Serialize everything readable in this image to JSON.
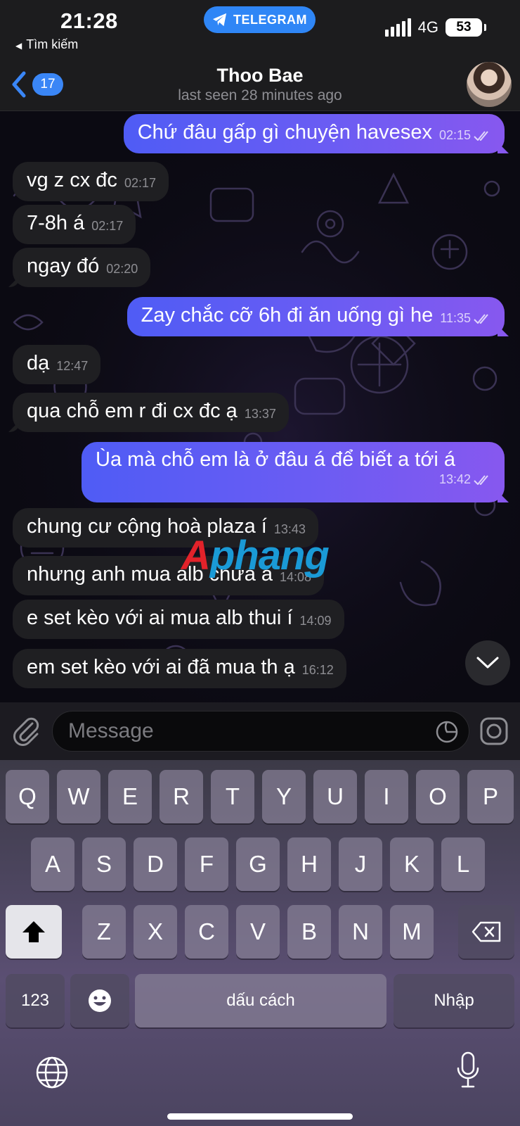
{
  "status_bar": {
    "time": "21:28",
    "back_label": "Tìm kiếm",
    "app_pill": "TELEGRAM",
    "network": "4G",
    "battery": "53"
  },
  "header": {
    "unread_count": "17",
    "title": "Thoo Bae",
    "subtitle": "last seen 28 minutes ago"
  },
  "messages": [
    {
      "dir": "out",
      "text": "Chứ đâu gấp gì chuyện havesex",
      "time": "02:15"
    },
    {
      "dir": "in",
      "text": "vg z cx đc",
      "time": "02:17"
    },
    {
      "dir": "in",
      "text": "7-8h á",
      "time": "02:17"
    },
    {
      "dir": "in",
      "text": "ngay đó",
      "time": "02:20"
    },
    {
      "dir": "out",
      "text": "Zay chắc cỡ 6h đi ăn uống gì he",
      "time": "11:35"
    },
    {
      "dir": "in",
      "text": "dạ",
      "time": "12:47"
    },
    {
      "dir": "in",
      "text": "qua chỗ em r đi cx đc ạ",
      "time": "13:37"
    },
    {
      "dir": "out",
      "text": "Ùa mà chỗ em là ở đâu á để biết a tới á",
      "time": "13:42"
    },
    {
      "dir": "in",
      "text": "chung cư cộng hoà plaza í",
      "time": "13:43"
    },
    {
      "dir": "in",
      "text": "nhưng anh mua alb chưa á",
      "time": "14:08"
    },
    {
      "dir": "in",
      "text": "e set kèo với ai mua alb thui í",
      "time": "14:09"
    },
    {
      "dir": "in",
      "text": "em set kèo với ai đã mua th ạ",
      "time": "16:12"
    }
  ],
  "watermark": {
    "first": "A",
    "rest": "phang"
  },
  "input": {
    "placeholder": "Message"
  },
  "keyboard": {
    "row1": [
      "Q",
      "W",
      "E",
      "R",
      "T",
      "Y",
      "U",
      "I",
      "O",
      "P"
    ],
    "row2": [
      "A",
      "S",
      "D",
      "F",
      "G",
      "H",
      "J",
      "K",
      "L"
    ],
    "row3": [
      "Z",
      "X",
      "C",
      "V",
      "B",
      "N",
      "M"
    ],
    "numbers_key": "123",
    "space_key": "dấu cách",
    "return_key": "Nhập"
  },
  "icons": [
    "telegram-plane-icon",
    "signal-icon",
    "battery-icon",
    "back-chevron-icon",
    "double-check-icon",
    "chevron-down-icon",
    "paperclip-icon",
    "sticker-icon",
    "camera-icon",
    "shift-icon",
    "backspace-icon",
    "emoji-icon",
    "globe-icon",
    "microphone-icon"
  ],
  "colors": {
    "accent": "#3a86f6",
    "outgoing_start": "#4f5cf5",
    "outgoing_end": "#8758ef",
    "incoming": "#1f1f22"
  }
}
